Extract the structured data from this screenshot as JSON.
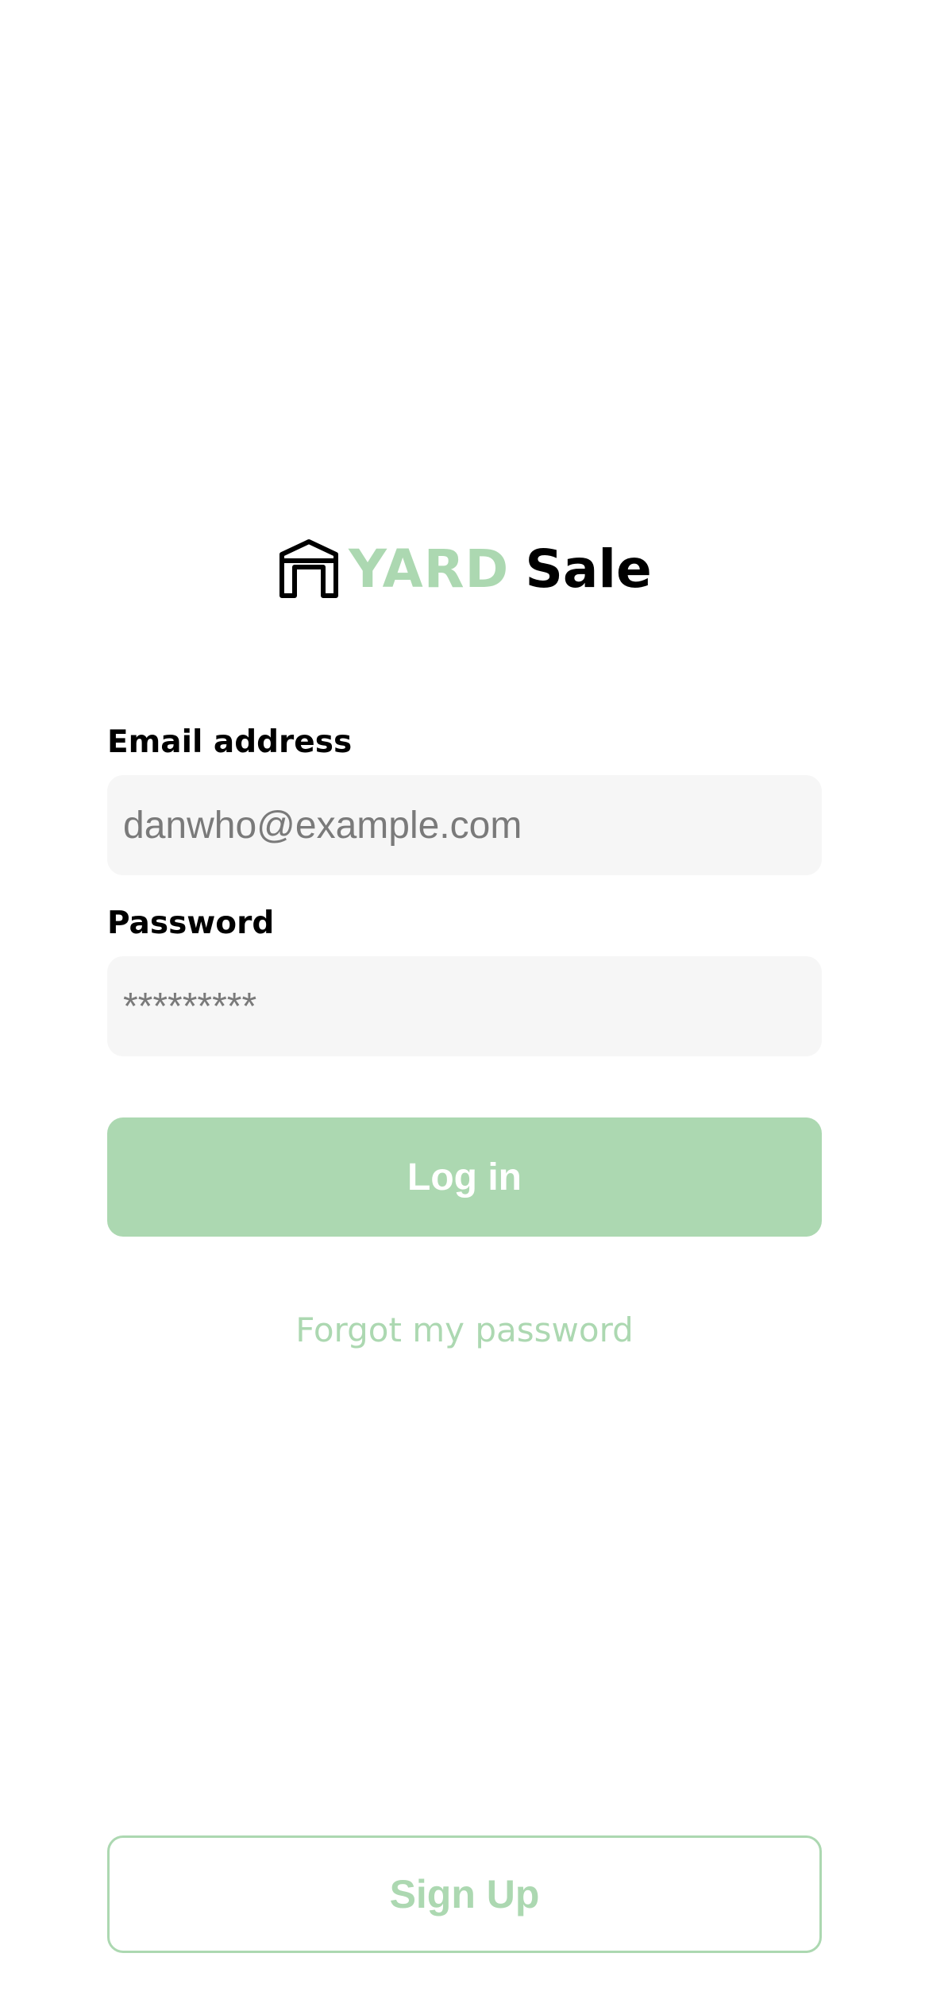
{
  "brand": {
    "name_part1": "YARD",
    "name_part2": "Sale",
    "icon": "garage-icon",
    "accent_color": "#acd8b1"
  },
  "login_form": {
    "email": {
      "label": "Email address",
      "placeholder": "danwho@example.com",
      "value": ""
    },
    "password": {
      "label": "Password",
      "placeholder": "*********",
      "value": ""
    },
    "login_label": "Log in",
    "forgot_label": "Forgot my password"
  },
  "signup": {
    "label": "Sign Up"
  }
}
